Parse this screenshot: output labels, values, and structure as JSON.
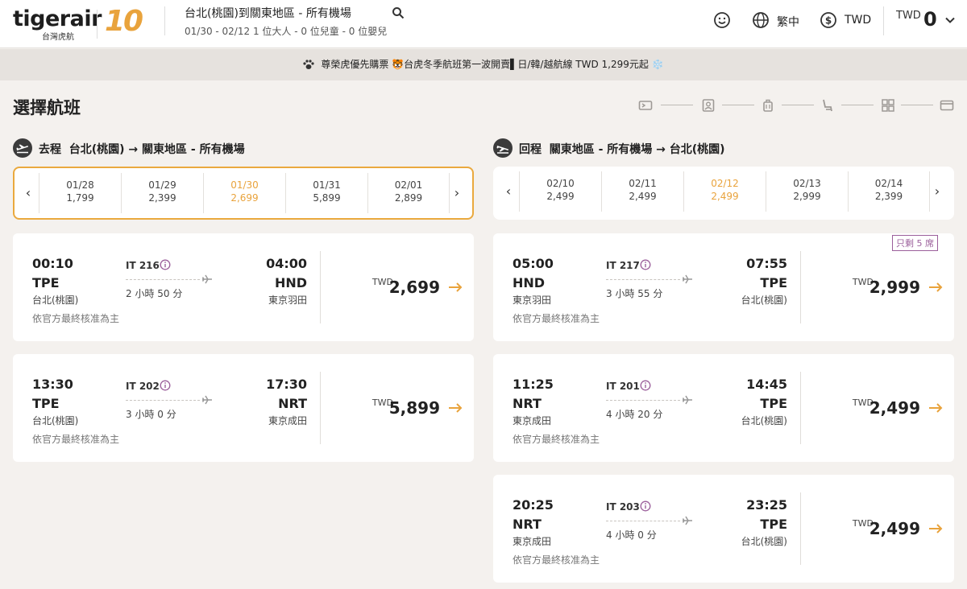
{
  "header": {
    "logo_text": "tigerair",
    "logo_sub": "台灣虎航",
    "logo_anniv": "10",
    "route": "台北(桃園)到關東地區 - 所有機場",
    "route_sub": "01/30 - 02/12   1 位大人 - 0 位兒童 - 0 位嬰兒",
    "language": "繁中",
    "currency": "TWD",
    "total_currency": "TWD",
    "total_value": "0"
  },
  "banner": {
    "text": "尊榮虎優先購票 🐯台虎冬季航班第一波開賣▌日/韓/越航線 TWD 1,299元起 ❄️"
  },
  "page": {
    "title": "選擇航班"
  },
  "outbound": {
    "label": "去程",
    "route": "台北(桃園) → 關東地區 - 所有機場",
    "dates": [
      {
        "date": "01/28",
        "price": "1,799"
      },
      {
        "date": "01/29",
        "price": "2,399"
      },
      {
        "date": "01/30",
        "price": "2,699"
      },
      {
        "date": "01/31",
        "price": "5,899"
      },
      {
        "date": "02/01",
        "price": "2,899"
      }
    ],
    "flights": [
      {
        "dep_time": "00:10",
        "dep_code": "TPE",
        "dep_city": "台北(桃園)",
        "flight_no": "IT 216",
        "duration": "2 小時 50 分",
        "arr_time": "04:00",
        "arr_code": "HND",
        "arr_city": "東京羽田",
        "note": "依官方最終核准為主",
        "currency": "TWD",
        "price": "2,699"
      },
      {
        "dep_time": "13:30",
        "dep_code": "TPE",
        "dep_city": "台北(桃園)",
        "flight_no": "IT 202",
        "duration": "3 小時 0 分",
        "arr_time": "17:30",
        "arr_code": "NRT",
        "arr_city": "東京成田",
        "note": "依官方最終核准為主",
        "currency": "TWD",
        "price": "5,899"
      }
    ]
  },
  "inbound": {
    "label": "回程",
    "route": "關東地區 - 所有機場 → 台北(桃園)",
    "dates": [
      {
        "date": "02/10",
        "price": "2,499"
      },
      {
        "date": "02/11",
        "price": "2,499"
      },
      {
        "date": "02/12",
        "price": "2,499"
      },
      {
        "date": "02/13",
        "price": "2,999"
      },
      {
        "date": "02/14",
        "price": "2,399"
      }
    ],
    "flights": [
      {
        "dep_time": "05:00",
        "dep_code": "HND",
        "dep_city": "東京羽田",
        "flight_no": "IT 217",
        "duration": "3 小時 55 分",
        "arr_time": "07:55",
        "arr_code": "TPE",
        "arr_city": "台北(桃園)",
        "note": "依官方最終核准為主",
        "currency": "TWD",
        "price": "2,999",
        "seats": "只剩 5 席"
      },
      {
        "dep_time": "11:25",
        "dep_code": "NRT",
        "dep_city": "東京成田",
        "flight_no": "IT 201",
        "duration": "4 小時 20 分",
        "arr_time": "14:45",
        "arr_code": "TPE",
        "arr_city": "台北(桃園)",
        "note": "依官方最終核准為主",
        "currency": "TWD",
        "price": "2,499"
      },
      {
        "dep_time": "20:25",
        "dep_code": "NRT",
        "dep_city": "東京成田",
        "flight_no": "IT 203",
        "duration": "4 小時 0 分",
        "arr_time": "23:25",
        "arr_code": "TPE",
        "arr_city": "台北(桃園)",
        "note": "依官方最終核准為主",
        "currency": "TWD",
        "price": "2,499"
      }
    ]
  },
  "colors": {
    "accent": "#e9a33c",
    "dark": "#3b3b3b",
    "seats": "#9b5f9b"
  },
  "icons": [
    "search-icon",
    "smiley-icon",
    "globe-icon",
    "dollar-icon",
    "chevron-down-icon",
    "paw-icon",
    "takeoff-icon",
    "landing-icon",
    "info-icon",
    "plane-icon",
    "arrow-right-icon"
  ]
}
